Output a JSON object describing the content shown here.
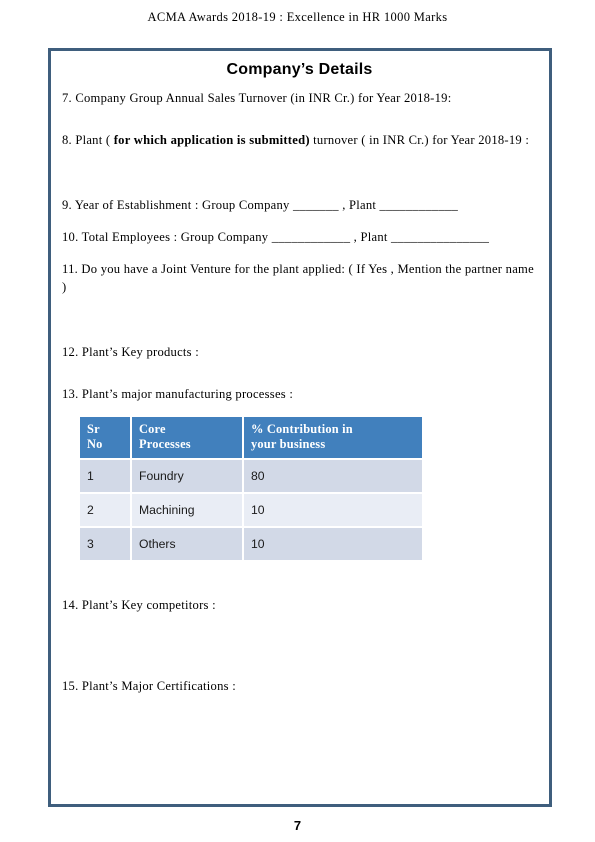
{
  "document": {
    "running_header": "ACMA  Awards  2018-19 : Excellence in HR 1000 Marks",
    "page_number": "7"
  },
  "form": {
    "section_title": "Company’s Details",
    "border_color": "#3f5e7d",
    "questions": {
      "q7": "7. Company Group Annual Sales Turnover (in INR Cr.) for Year 2018-19:",
      "q8_part1": "8. Plant ( ",
      "q8_bold": "for which application is submitted)",
      "q8_part2": " turnover ( in INR Cr.) for  Year 2018-19 :",
      "q9": "9.  Year  of  Establishment  :  Group Company  _______ , Plant ____________",
      "q10": "10. Total  Employees :  Group Company  ____________ , Plant _______________",
      "q11": "11. Do  you  have  a Joint  Venture  for the plant applied: (  If  Yes , Mention the  partner  name )",
      "q12": "12. Plant’s  Key  products  :",
      "q13": "13. Plant’s  major  manufacturing  processes :",
      "q14": "14. Plant’s  Key  competitors   :",
      "q15": "15. Plant’s Major  Certifications  :"
    }
  },
  "processes_table": {
    "header_background": "#4180bd",
    "row_background_a": "#d2d9e7",
    "row_background_b": "#e9edf5",
    "columns": [
      {
        "label": "Sr No"
      },
      {
        "label": "Core Processes"
      },
      {
        "label": "% Contribution in your business"
      }
    ],
    "headers": {
      "sr_no_line1": "Sr",
      "sr_no_line2": "No",
      "core_line1": "Core",
      "core_line2": "Processes",
      "pct_line1": "% Contribution in",
      "pct_line2": "your business"
    },
    "rows": [
      {
        "sr_no": "1",
        "process": "Foundry",
        "contribution": "80"
      },
      {
        "sr_no": "2",
        "process": "Machining",
        "contribution": "10"
      },
      {
        "sr_no": "3",
        "process": "Others",
        "contribution": "10"
      }
    ]
  }
}
